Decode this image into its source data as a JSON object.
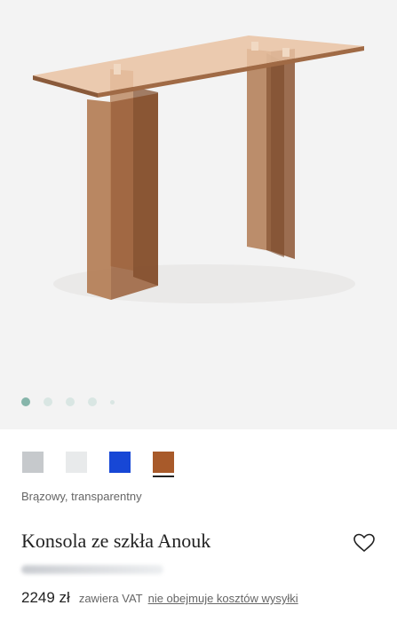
{
  "product": {
    "name": "Konsola ze szkła Anouk",
    "color_name": "Brązowy, transparentny",
    "price": "2249 zł",
    "vat_note": "zawiera VAT",
    "shipping_link": "nie obejmuje kosztów wysyłki",
    "hidden_text": "We"
  },
  "gallery": {
    "image": "glass-console-table-photo",
    "current_slide": 1,
    "slides_visible": 5
  },
  "swatches": [
    {
      "name": "grey",
      "color": "#c6c9cc",
      "selected": false
    },
    {
      "name": "white",
      "color": "#e8eaeb",
      "selected": false
    },
    {
      "name": "blue",
      "color": "#1747d6",
      "selected": false
    },
    {
      "name": "brown",
      "color": "#a85a2a",
      "selected": true
    }
  ],
  "icons": {
    "favorite": "heart-outline-icon"
  }
}
